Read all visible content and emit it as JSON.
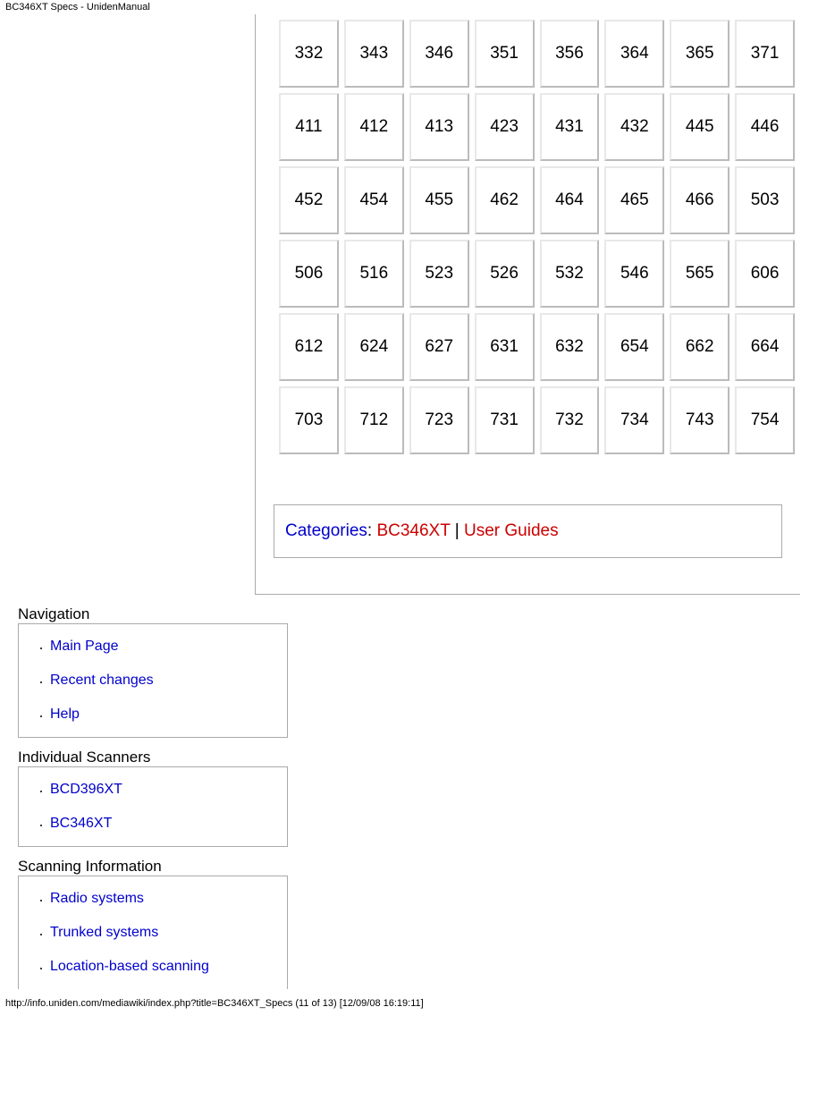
{
  "header": {
    "title": "BC346XT Specs - UnidenManual"
  },
  "chart_data": {
    "type": "table",
    "title": "",
    "rows": [
      [
        "332",
        "343",
        "346",
        "351",
        "356",
        "364",
        "365",
        "371"
      ],
      [
        "411",
        "412",
        "413",
        "423",
        "431",
        "432",
        "445",
        "446"
      ],
      [
        "452",
        "454",
        "455",
        "462",
        "464",
        "465",
        "466",
        "503"
      ],
      [
        "506",
        "516",
        "523",
        "526",
        "532",
        "546",
        "565",
        "606"
      ],
      [
        "612",
        "624",
        "627",
        "631",
        "632",
        "654",
        "662",
        "664"
      ],
      [
        "703",
        "712",
        "723",
        "731",
        "732",
        "734",
        "743",
        "754"
      ]
    ]
  },
  "categories": {
    "label": "Categories",
    "sep1": ": ",
    "item1": "BC346XT",
    "sep2": " | ",
    "item2": "User Guides"
  },
  "nav": {
    "navigation": {
      "heading": "Navigation",
      "items": [
        "Main Page",
        "Recent changes",
        "Help"
      ]
    },
    "scanners": {
      "heading": "Individual Scanners",
      "items": [
        "BCD396XT",
        "BC346XT"
      ]
    },
    "scanning": {
      "heading": "Scanning Information",
      "items": [
        "Radio systems",
        "Trunked systems",
        "Location-based scanning"
      ]
    }
  },
  "footer": {
    "text": "http://info.uniden.com/mediawiki/index.php?title=BC346XT_Specs (11 of 13) [12/09/08 16:19:11]"
  }
}
